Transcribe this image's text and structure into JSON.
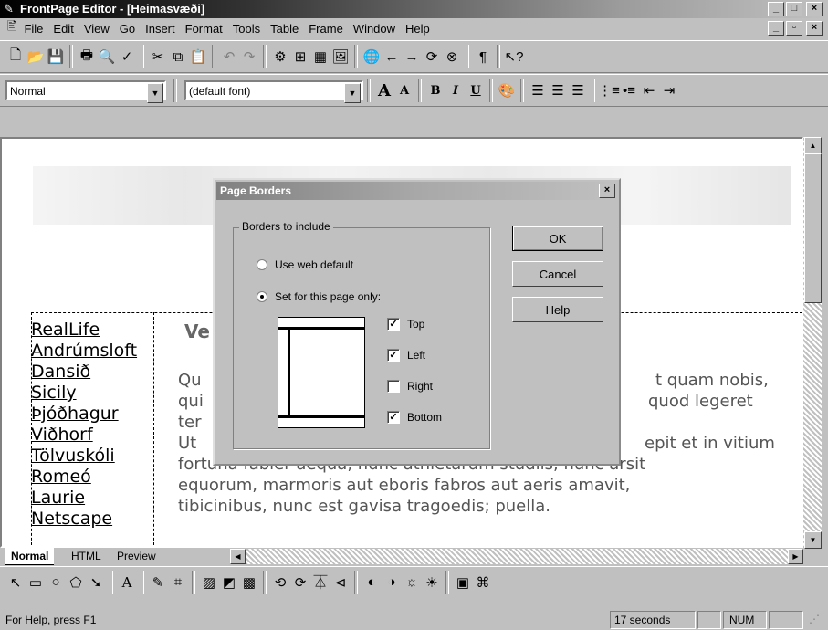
{
  "window": {
    "title": "FrontPage Editor - [Heimasvæði]"
  },
  "menu": [
    "File",
    "Edit",
    "View",
    "Go",
    "Insert",
    "Format",
    "Tools",
    "Table",
    "Frame",
    "Window",
    "Help"
  ],
  "format_bar": {
    "style": "Normal",
    "font": "(default font)",
    "bold": "B",
    "italic": "I",
    "underline": "U"
  },
  "nav_links": [
    "RealLife",
    "Andrúmsloft",
    "Dansið",
    "Sicily",
    "Þjóðhagur",
    "Viðhorf",
    "Tölvuskóli",
    "Romeó",
    "Laurie",
    "Netscape"
  ],
  "content": {
    "heading": "Ve",
    "line1_left": "Qu",
    "line1_right": "t quam nobis,",
    "line2_left": "qui",
    "line2_right": "quod legeret",
    "line3_left": "ter",
    "line4_left": "Ut",
    "line4_right": "epit et in vitium",
    "line5": "fortuna fabler aequa, nunc athletarum studiis, nunc arsit",
    "line6": "equorum, marmoris aut eboris fabros aut aeris amavit,",
    "line7": "tibicinibus, nunc est gavisa tragoedis; puella."
  },
  "tabs": [
    "Normal",
    "HTML",
    "Preview"
  ],
  "status": {
    "help": "For Help, press F1",
    "time": "17 seconds",
    "num": "NUM"
  },
  "dialog": {
    "title": "Page Borders",
    "group_label": "Borders to include",
    "use_default": "Use web default",
    "set_page": "Set for this page only:",
    "selected_option": "Set for this page only:",
    "top": "Top",
    "left": "Left",
    "right": "Right",
    "bottom": "Bottom",
    "checked": {
      "top": true,
      "left": true,
      "right": false,
      "bottom": true
    },
    "ok": "OK",
    "cancel": "Cancel",
    "help": "Help"
  },
  "colors": {
    "titlebar_start": "#000000",
    "titlebar_end": "#c0c0c0",
    "face": "#c0c0c0"
  }
}
